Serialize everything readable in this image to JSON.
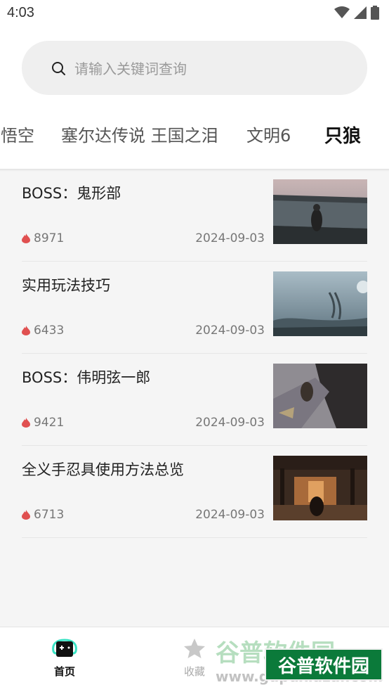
{
  "status_bar": {
    "time": "4:03"
  },
  "search": {
    "placeholder": "请输入关键词查询"
  },
  "tabs": [
    {
      "label": "悟空",
      "active": false
    },
    {
      "label": "塞尔达传说 王国之泪",
      "active": false
    },
    {
      "label": "文明6",
      "active": false
    },
    {
      "label": "只狼",
      "active": true
    }
  ],
  "articles": [
    {
      "title": "BOSS：鬼形部",
      "views": "8971",
      "date": "2024-09-03",
      "thumb_scene": "castle-wall-dusk"
    },
    {
      "title": "实用玩法技巧",
      "views": "6433",
      "date": "2024-09-03",
      "thumb_scene": "misty-centipede"
    },
    {
      "title": "BOSS：伟明弦一郎",
      "views": "9421",
      "date": "2024-09-03",
      "thumb_scene": "rooftop-leap"
    },
    {
      "title": "全义手忍具使用方法总览",
      "views": "6713",
      "date": "2024-09-03",
      "thumb_scene": "dojo-interior"
    }
  ],
  "bottom_nav": [
    {
      "label": "首页",
      "icon": "gamepad-icon",
      "active": true
    },
    {
      "label": "收藏",
      "icon": "star-icon",
      "active": false
    }
  ],
  "watermark": {
    "text_back": "谷普软件园",
    "url": "www.gupuxiazai.com",
    "text_front": "谷普软件园"
  },
  "colors": {
    "accent": "#39e3c4",
    "fire": "#e05050",
    "watermark_green": "#0b7a3a"
  }
}
